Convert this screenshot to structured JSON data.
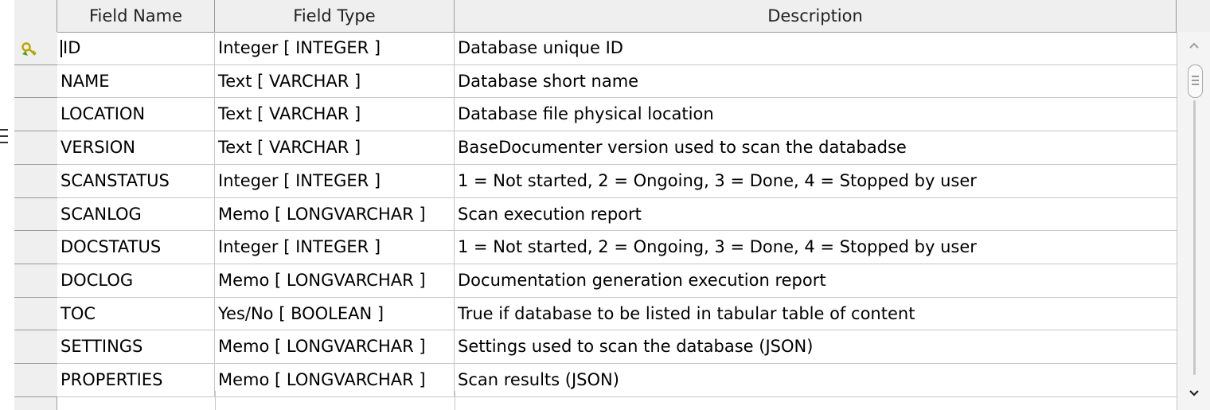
{
  "columns": {
    "field_name": "Field Name",
    "field_type": "Field Type",
    "description": "Description"
  },
  "rows": [
    {
      "name": "ID",
      "type": "Integer [ INTEGER ]",
      "description": "Database unique ID",
      "primary_key": true
    },
    {
      "name": "NAME",
      "type": "Text [ VARCHAR ]",
      "description": "Database short name"
    },
    {
      "name": "LOCATION",
      "type": "Text [ VARCHAR ]",
      "description": "Database file physical location"
    },
    {
      "name": "VERSION",
      "type": "Text [ VARCHAR ]",
      "description": "BaseDocumenter version used to scan the databadse"
    },
    {
      "name": "SCANSTATUS",
      "type": "Integer [ INTEGER ]",
      "description": "1 = Not started, 2 = Ongoing, 3 = Done, 4 = Stopped by user"
    },
    {
      "name": "SCANLOG",
      "type": "Memo [ LONGVARCHAR ]",
      "description": "Scan execution report"
    },
    {
      "name": "DOCSTATUS",
      "type": "Integer [ INTEGER ]",
      "description": "1 = Not started, 2 = Ongoing, 3 = Done, 4 = Stopped by user"
    },
    {
      "name": "DOCLOG",
      "type": "Memo [ LONGVARCHAR ]",
      "description": "Documentation generation execution report"
    },
    {
      "name": "TOC",
      "type": "Yes/No [ BOOLEAN ]",
      "description": "True if database to be listed in tabular table of content"
    },
    {
      "name": "SETTINGS",
      "type": "Memo [ LONGVARCHAR ]",
      "description": "Settings used to scan the database (JSON)"
    },
    {
      "name": "PROPERTIES",
      "type": "Memo [ LONGVARCHAR ]",
      "description": "Scan results (JSON)"
    }
  ],
  "icons": {
    "primary_key": "key-icon",
    "scroll_up": "chevron-up-icon",
    "scroll_down": "chevron-down-icon"
  },
  "colors": {
    "header_bg": "#efefef",
    "grid_line": "#c6c6c6",
    "key_icon": "#c8b400"
  }
}
